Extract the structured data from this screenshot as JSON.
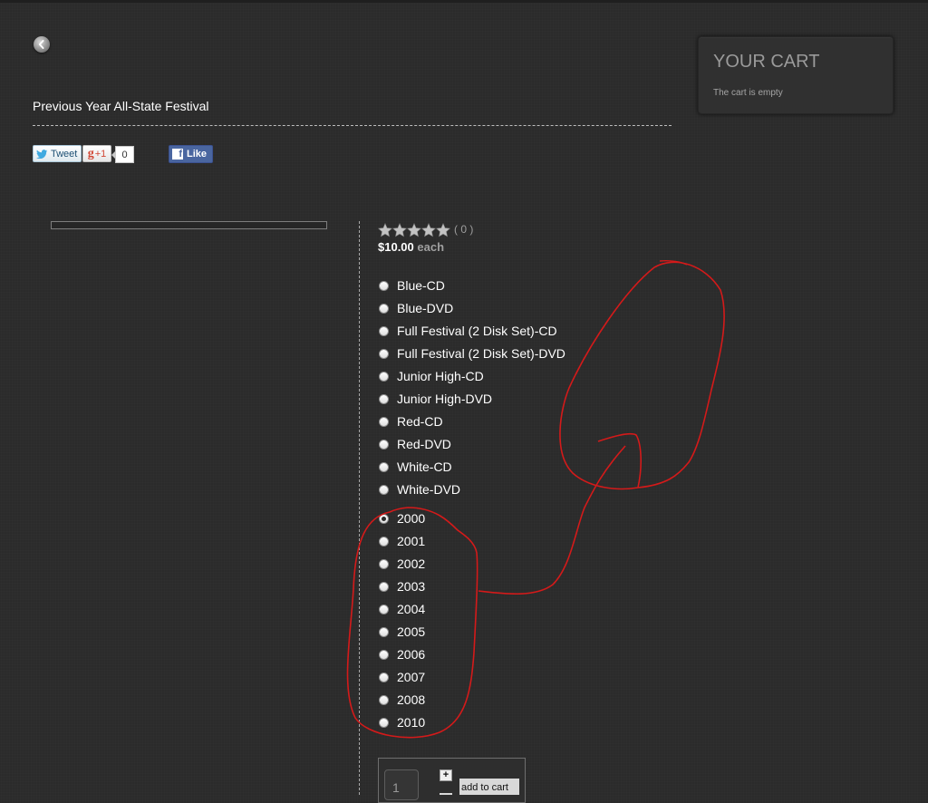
{
  "header": {
    "back_icon": "chevron-left-icon",
    "title": "Previous Year All-State Festival"
  },
  "social": {
    "tweet_label": "Tweet",
    "gplus_label": "+1",
    "gplus_count": "0",
    "fb_like_label": "Like"
  },
  "cart": {
    "title": "YOUR CART",
    "status": "The cart is empty"
  },
  "product": {
    "rating_count": "( 0 )",
    "rating_stars_filled": 0,
    "rating_stars_total": 5,
    "price": "$10.00",
    "price_unit": "each",
    "format_options": [
      "Blue-CD",
      "Blue-DVD",
      "Full Festival (2 Disk Set)-CD",
      "Full Festival (2 Disk Set)-DVD",
      "Junior High-CD",
      "Junior High-DVD",
      "Red-CD",
      "Red-DVD",
      "White-CD",
      "White-DVD"
    ],
    "year_options": [
      "2000",
      "2001",
      "2002",
      "2003",
      "2004",
      "2005",
      "2006",
      "2007",
      "2008",
      "2010"
    ],
    "selected_year": "2000",
    "quantity": "1",
    "plus_label": "+",
    "add_to_cart_label": "add to cart"
  },
  "colors": {
    "background": "#2b2b2b",
    "annotation": "#d41a1a",
    "cart_title": "#9a9a9a"
  }
}
